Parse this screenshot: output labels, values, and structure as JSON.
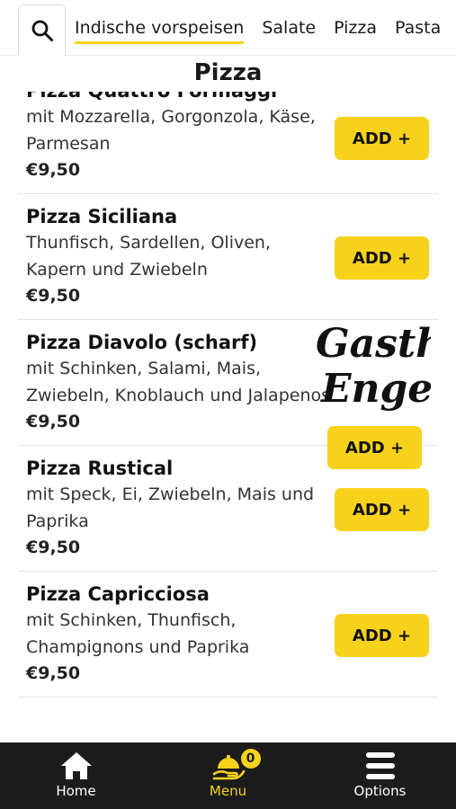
{
  "header": {
    "search_icon": "search-icon",
    "tabs": [
      {
        "label": "Indische vorspeisen",
        "active": true
      },
      {
        "label": "Salate",
        "active": false
      },
      {
        "label": "Pizza",
        "active": false
      },
      {
        "label": "Pasta",
        "active": false
      }
    ]
  },
  "section": {
    "title": "Pizza"
  },
  "items": [
    {
      "name": "Pizza Quattro Formaggi",
      "desc": "mit Mozzarella, Gorgonzola, Käse, Parmesan",
      "price": "€9,50",
      "add_label": "ADD +"
    },
    {
      "name": "Pizza Siciliana",
      "desc": "Thunfisch, Sardellen, Oliven, Kapern und Zwiebeln",
      "price": "€9,50",
      "add_label": "ADD +"
    },
    {
      "name": "Pizza Diavolo (scharf)",
      "desc": "mit Schinken, Salami, Mais, Zwiebeln, Knoblauch und Jalapenos",
      "price": "€9,50",
      "add_label": "ADD +"
    },
    {
      "name": "Pizza Rustical",
      "desc": "mit Speck, Ei, Zwiebeln, Mais und Paprika",
      "price": "€9,50",
      "add_label": "ADD +"
    },
    {
      "name": "Pizza Capricciosa",
      "desc": "mit Schinken, Thunfisch, Champignons und Paprika",
      "price": "€9,50",
      "add_label": "ADD +"
    }
  ],
  "watermark": {
    "line1": "Gasthof",
    "line2": "Engel"
  },
  "bottom_nav": {
    "home": {
      "label": "Home",
      "icon": "home-icon"
    },
    "menu": {
      "label": "Menu",
      "icon": "service-bell-icon",
      "badge": "0"
    },
    "options": {
      "label": "Options",
      "icon": "hamburger-menu-icon"
    }
  },
  "colors": {
    "accent": "#f7d21a",
    "nav_background": "#1c1c1c"
  }
}
